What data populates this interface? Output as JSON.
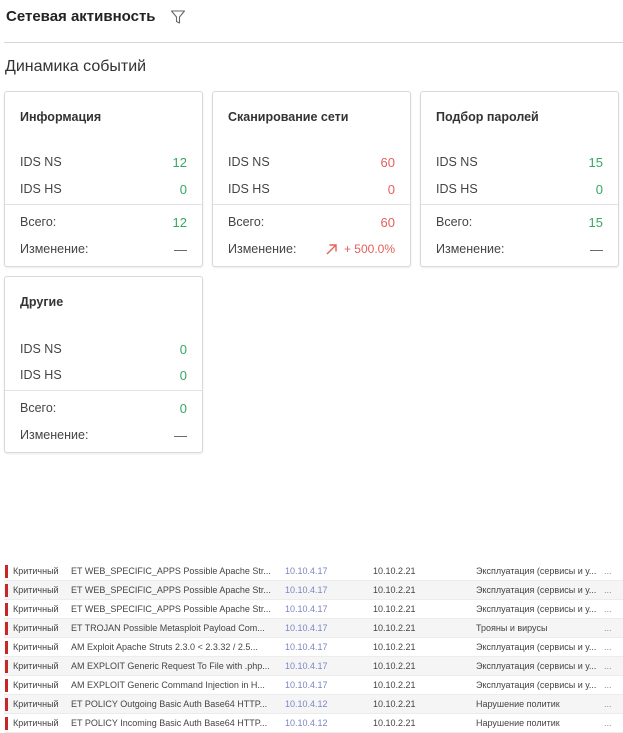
{
  "header": {
    "title": "Сетевая активность"
  },
  "section": {
    "title": "Динамика событий"
  },
  "cards": [
    {
      "title": "Информация",
      "ids_ns_label": "IDS NS",
      "ids_ns": "12",
      "ids_hs_label": "IDS HS",
      "ids_hs": "0",
      "total_label": "Всего:",
      "total": "12",
      "change_label": "Изменение:",
      "change": "—"
    },
    {
      "title": "Сканирование сети",
      "ids_ns_label": "IDS NS",
      "ids_ns": "60",
      "ids_hs_label": "IDS HS",
      "ids_hs": "0",
      "total_label": "Всего:",
      "total": "60",
      "change_label": "Изменение:",
      "change": "+ 500.0%"
    },
    {
      "title": "Подбор паролей",
      "ids_ns_label": "IDS NS",
      "ids_ns": "15",
      "ids_hs_label": "IDS HS",
      "ids_hs": "0",
      "total_label": "Всего:",
      "total": "15",
      "change_label": "Изменение:",
      "change": "—"
    },
    {
      "title": "Другие",
      "ids_ns_label": "IDS NS",
      "ids_ns": "0",
      "ids_hs_label": "IDS HS",
      "ids_hs": "0",
      "total_label": "Всего:",
      "total": "0",
      "change_label": "Изменение:",
      "change": "—"
    }
  ],
  "colors": {
    "positive": "#37a860",
    "negative": "#e5605a",
    "critical": "#c62828",
    "ip_link": "#7b86c4"
  },
  "events": [
    {
      "severity": "Критичный",
      "name": "ET WEB_SPECIFIC_APPS Possible Apache Str...",
      "src": "10.10.4.17",
      "dst": "10.10.2.21",
      "category": "Эксплуатация (сервисы и у...",
      "more": "..."
    },
    {
      "severity": "Критичный",
      "name": "ET WEB_SPECIFIC_APPS Possible Apache Str...",
      "src": "10.10.4.17",
      "dst": "10.10.2.21",
      "category": "Эксплуатация (сервисы и у...",
      "more": "..."
    },
    {
      "severity": "Критичный",
      "name": "ET WEB_SPECIFIC_APPS Possible Apache Str...",
      "src": "10.10.4.17",
      "dst": "10.10.2.21",
      "category": "Эксплуатация (сервисы и у...",
      "more": "..."
    },
    {
      "severity": "Критичный",
      "name": "ET TROJAN Possible Metasploit Payload Com...",
      "src": "10.10.4.17",
      "dst": "10.10.2.21",
      "category": "Трояны и вирусы",
      "more": "..."
    },
    {
      "severity": "Критичный",
      "name": "AM Exploit Apache Struts 2.3.0 < 2.3.32 / 2.5...",
      "src": "10.10.4.17",
      "dst": "10.10.2.21",
      "category": "Эксплуатация (сервисы и у...",
      "more": "..."
    },
    {
      "severity": "Критичный",
      "name": "AM EXPLOIT Generic Request To File with .php...",
      "src": "10.10.4.17",
      "dst": "10.10.2.21",
      "category": "Эксплуатация (сервисы и у...",
      "more": "..."
    },
    {
      "severity": "Критичный",
      "name": "AM EXPLOIT Generic Command Injection in H...",
      "src": "10.10.4.17",
      "dst": "10.10.2.21",
      "category": "Эксплуатация (сервисы и у...",
      "more": "..."
    },
    {
      "severity": "Критичный",
      "name": "ET POLICY Outgoing Basic Auth Base64 HTTP...",
      "src": "10.10.4.12",
      "dst": "10.10.2.21",
      "category": "Нарушение политик",
      "more": "..."
    },
    {
      "severity": "Критичный",
      "name": "ET POLICY Incoming Basic Auth Base64 HTTP...",
      "src": "10.10.4.12",
      "dst": "10.10.2.21",
      "category": "Нарушение политик",
      "more": "..."
    }
  ]
}
